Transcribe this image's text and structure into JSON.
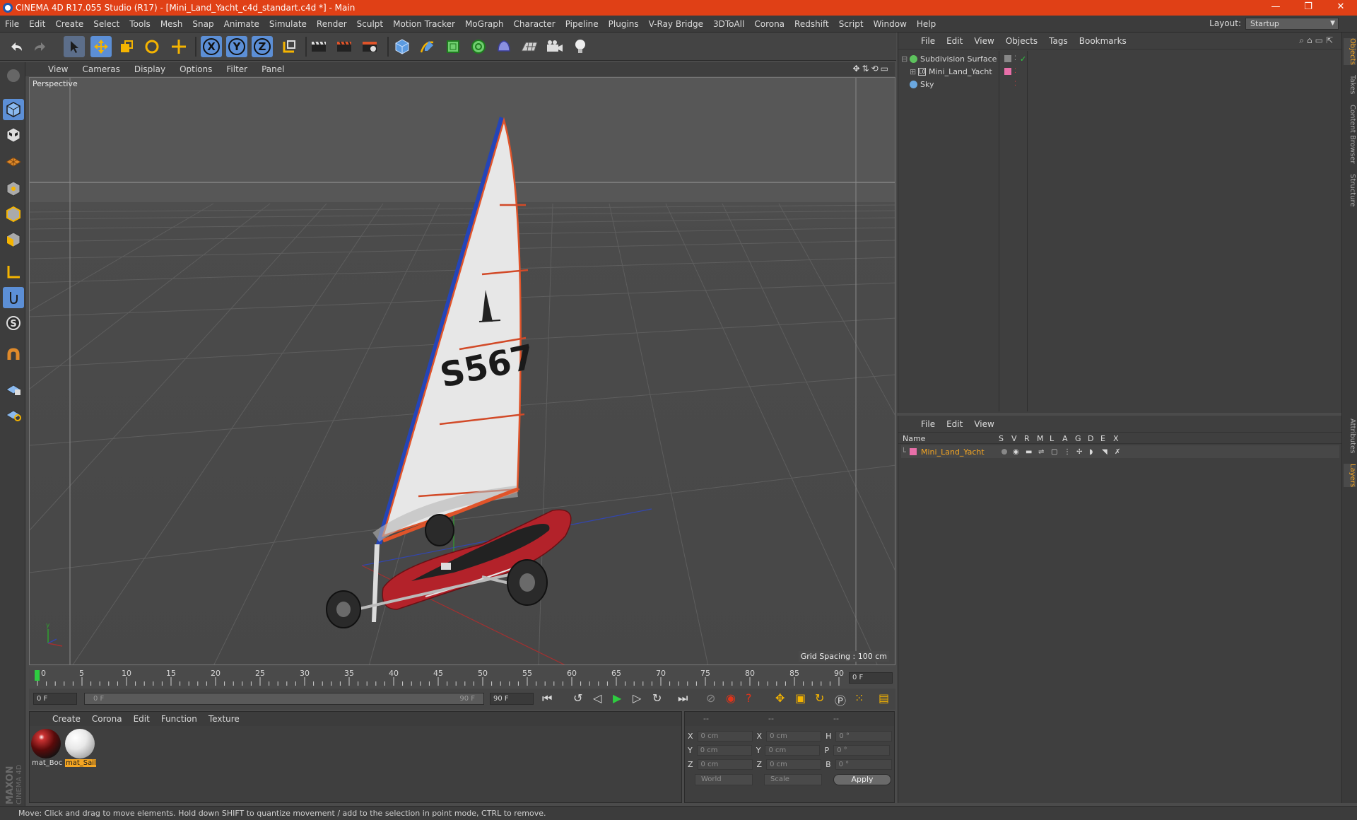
{
  "titlebar": {
    "title": "CINEMA 4D R17.055 Studio (R17) - [Mini_Land_Yacht_c4d_standart.c4d *] - Main",
    "minimize": "—",
    "restore": "❐",
    "close": "✕"
  },
  "menubar": {
    "items": [
      "File",
      "Edit",
      "Create",
      "Select",
      "Tools",
      "Mesh",
      "Snap",
      "Animate",
      "Simulate",
      "Render",
      "Sculpt",
      "Motion Tracker",
      "MoGraph",
      "Character",
      "Pipeline",
      "Plugins",
      "V-Ray Bridge",
      "3DToAll",
      "Corona",
      "Redshift",
      "Script",
      "Window",
      "Help"
    ],
    "layout_label": "Layout:",
    "layout_value": "Startup"
  },
  "toolbar": {
    "axis_x": "X",
    "axis_y": "Y",
    "axis_z": "Z"
  },
  "viewport": {
    "menu": [
      "View",
      "Cameras",
      "Display",
      "Options",
      "Filter",
      "Panel"
    ],
    "label": "Perspective",
    "grid_spacing": "Grid Spacing : 100 cm",
    "sail_number": "S567"
  },
  "timeline": {
    "ticks": [
      "0",
      "5",
      "10",
      "15",
      "20",
      "25",
      "30",
      "35",
      "40",
      "45",
      "50",
      "55",
      "60",
      "65",
      "70",
      "75",
      "80",
      "85",
      "90"
    ],
    "current_frame": "0 F",
    "start_field": "0 F",
    "range_start": "0 F",
    "range_end": "90 F",
    "end_field": "90 F"
  },
  "materials": {
    "menu": [
      "Create",
      "Corona",
      "Edit",
      "Function",
      "Texture"
    ],
    "items": [
      {
        "label": "mat_Boc"
      },
      {
        "label": "mat_Sail"
      }
    ]
  },
  "coordinates": {
    "headers": [
      "--",
      "--",
      "--"
    ],
    "rows": [
      {
        "axis": "X",
        "pos": "0 cm",
        "axis2": "X",
        "size": "0 cm",
        "axis3": "H",
        "rot": "0 °"
      },
      {
        "axis": "Y",
        "pos": "0 cm",
        "axis2": "Y",
        "size": "0 cm",
        "axis3": "P",
        "rot": "0 °"
      },
      {
        "axis": "Z",
        "pos": "0 cm",
        "axis2": "Z",
        "size": "0 cm",
        "axis3": "B",
        "rot": "0 °"
      }
    ],
    "world": "World",
    "scale": "Scale",
    "apply": "Apply"
  },
  "object_manager": {
    "menu": [
      "File",
      "Edit",
      "View",
      "Objects",
      "Tags",
      "Bookmarks"
    ],
    "objects": [
      {
        "name": "Subdivision Surface"
      },
      {
        "name": "Mini_Land_Yacht"
      },
      {
        "name": "Sky"
      }
    ]
  },
  "layer_manager": {
    "menu": [
      "File",
      "Edit",
      "View"
    ],
    "columns": [
      "Name",
      "S",
      "V",
      "R",
      "M",
      "L",
      "A",
      "G",
      "D",
      "E",
      "X"
    ],
    "layers": [
      {
        "name": "Mini_Land_Yacht",
        "color": "#e86fa9"
      }
    ]
  },
  "right_tabs": [
    "Objects",
    "Takes",
    "Content Browser",
    "Structure",
    "Attributes",
    "Layers"
  ],
  "branding": "MAXON CINEMA 4D",
  "status": "Move: Click and drag to move elements. Hold down SHIFT to quantize movement / add to the selection in point mode, CTRL to remove.",
  "colors": {
    "titlebar": "#e04016",
    "accent_orange": "#f5a623",
    "active_blue": "#5c8fd6"
  }
}
